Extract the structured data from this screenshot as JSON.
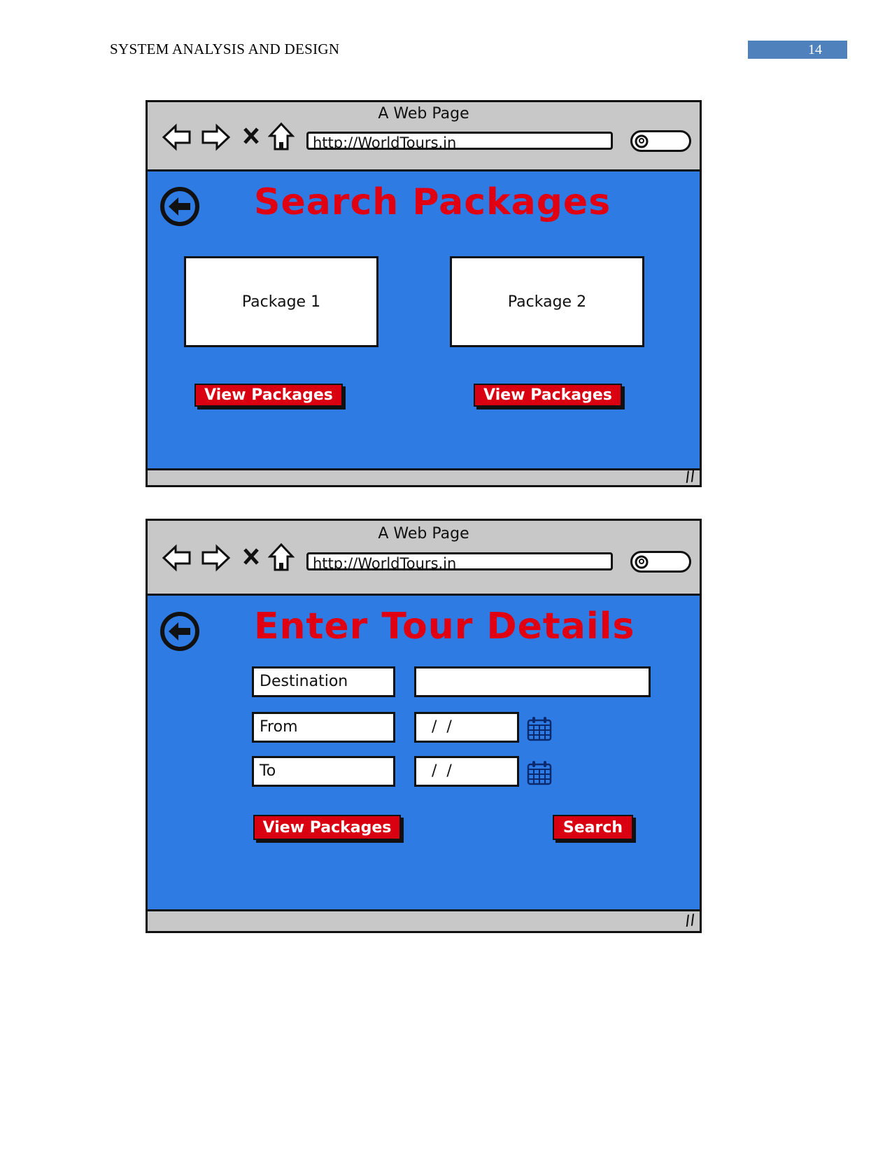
{
  "header": {
    "title": "SYSTEM ANALYSIS AND DESIGN",
    "page_number": "14"
  },
  "colors": {
    "content_bg": "#2e7be3",
    "title_red": "#e00012",
    "button_red": "#d90012",
    "chrome_gray": "#c8c8c8",
    "page_number_bg": "#4f81bd"
  },
  "mockup1": {
    "window_title": "A Web Page",
    "url": "http://WorldTours.in",
    "heading": "Search Packages",
    "packages": [
      {
        "label": "Package 1",
        "button": "View Packages"
      },
      {
        "label": "Package 2",
        "button": "View Packages"
      }
    ]
  },
  "mockup2": {
    "window_title": "A Web Page",
    "url": "http://WorldTours.in",
    "heading": "Enter Tour Details",
    "fields": [
      {
        "label": "Destination",
        "value": ""
      },
      {
        "label": "From",
        "value": "  /  /"
      },
      {
        "label": "To",
        "value": "  /  /"
      }
    ],
    "view_packages_label": "View Packages",
    "search_label": "Search"
  }
}
